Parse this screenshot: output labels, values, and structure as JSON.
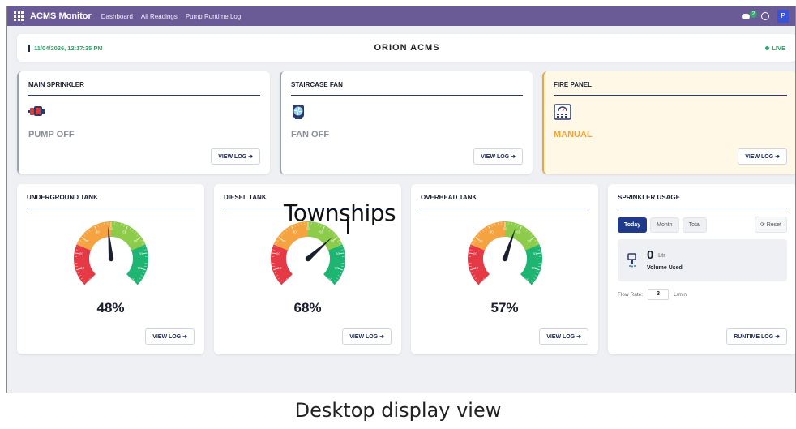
{
  "nav": {
    "brand": "ACMS Monitor",
    "links": [
      "Dashboard",
      "All Readings",
      "Pump Runtime Log"
    ],
    "chat_badge": "2",
    "avatar": "P"
  },
  "status": {
    "timestamp": "11/04/2026, 12:17:35 PM",
    "title": "ORION ACMS",
    "live": "LIVE"
  },
  "controls": [
    {
      "title": "MAIN SPRINKLER",
      "state": "PUMP OFF",
      "button": "VIEW LOG ➜"
    },
    {
      "title": "STAIRCASE FAN",
      "state": "FAN OFF",
      "button": "VIEW LOG ➜"
    },
    {
      "title": "FIRE PANEL",
      "state": "MANUAL",
      "button": "VIEW LOG ➜"
    }
  ],
  "tanks": [
    {
      "title": "UNDERGROUND TANK",
      "percent": "48%",
      "level": 48,
      "button": "VIEW LOG ➜"
    },
    {
      "title": "DIESEL TANK",
      "percent": "68%",
      "level": 68,
      "button": "VIEW LOG ➜"
    },
    {
      "title": "OVERHEAD TANK",
      "percent": "57%",
      "level": 57,
      "button": "VIEW LOG ➜"
    }
  ],
  "gauge_ticks": [
    "0",
    "10",
    "20",
    "30",
    "40",
    "50",
    "60",
    "70",
    "80",
    "90",
    "100"
  ],
  "gauge_colors": {
    "low": "#e63946",
    "mid": "#f4a340",
    "high": "#8ccc4a",
    "full": "#1eb573"
  },
  "usage": {
    "title": "SPRINKLER USAGE",
    "tabs": [
      "Today",
      "Month",
      "Total"
    ],
    "active_tab": "Today",
    "reset": "⟳ Reset",
    "volume": "0",
    "unit": "Ltr",
    "volume_label": "Volume Used",
    "flow_label": "Flow Rate:",
    "flow_value": "3",
    "flow_unit": "L/min",
    "button": "RUNTIME LOG ➜"
  },
  "overlay": "Townships",
  "caption": "Desktop display view"
}
